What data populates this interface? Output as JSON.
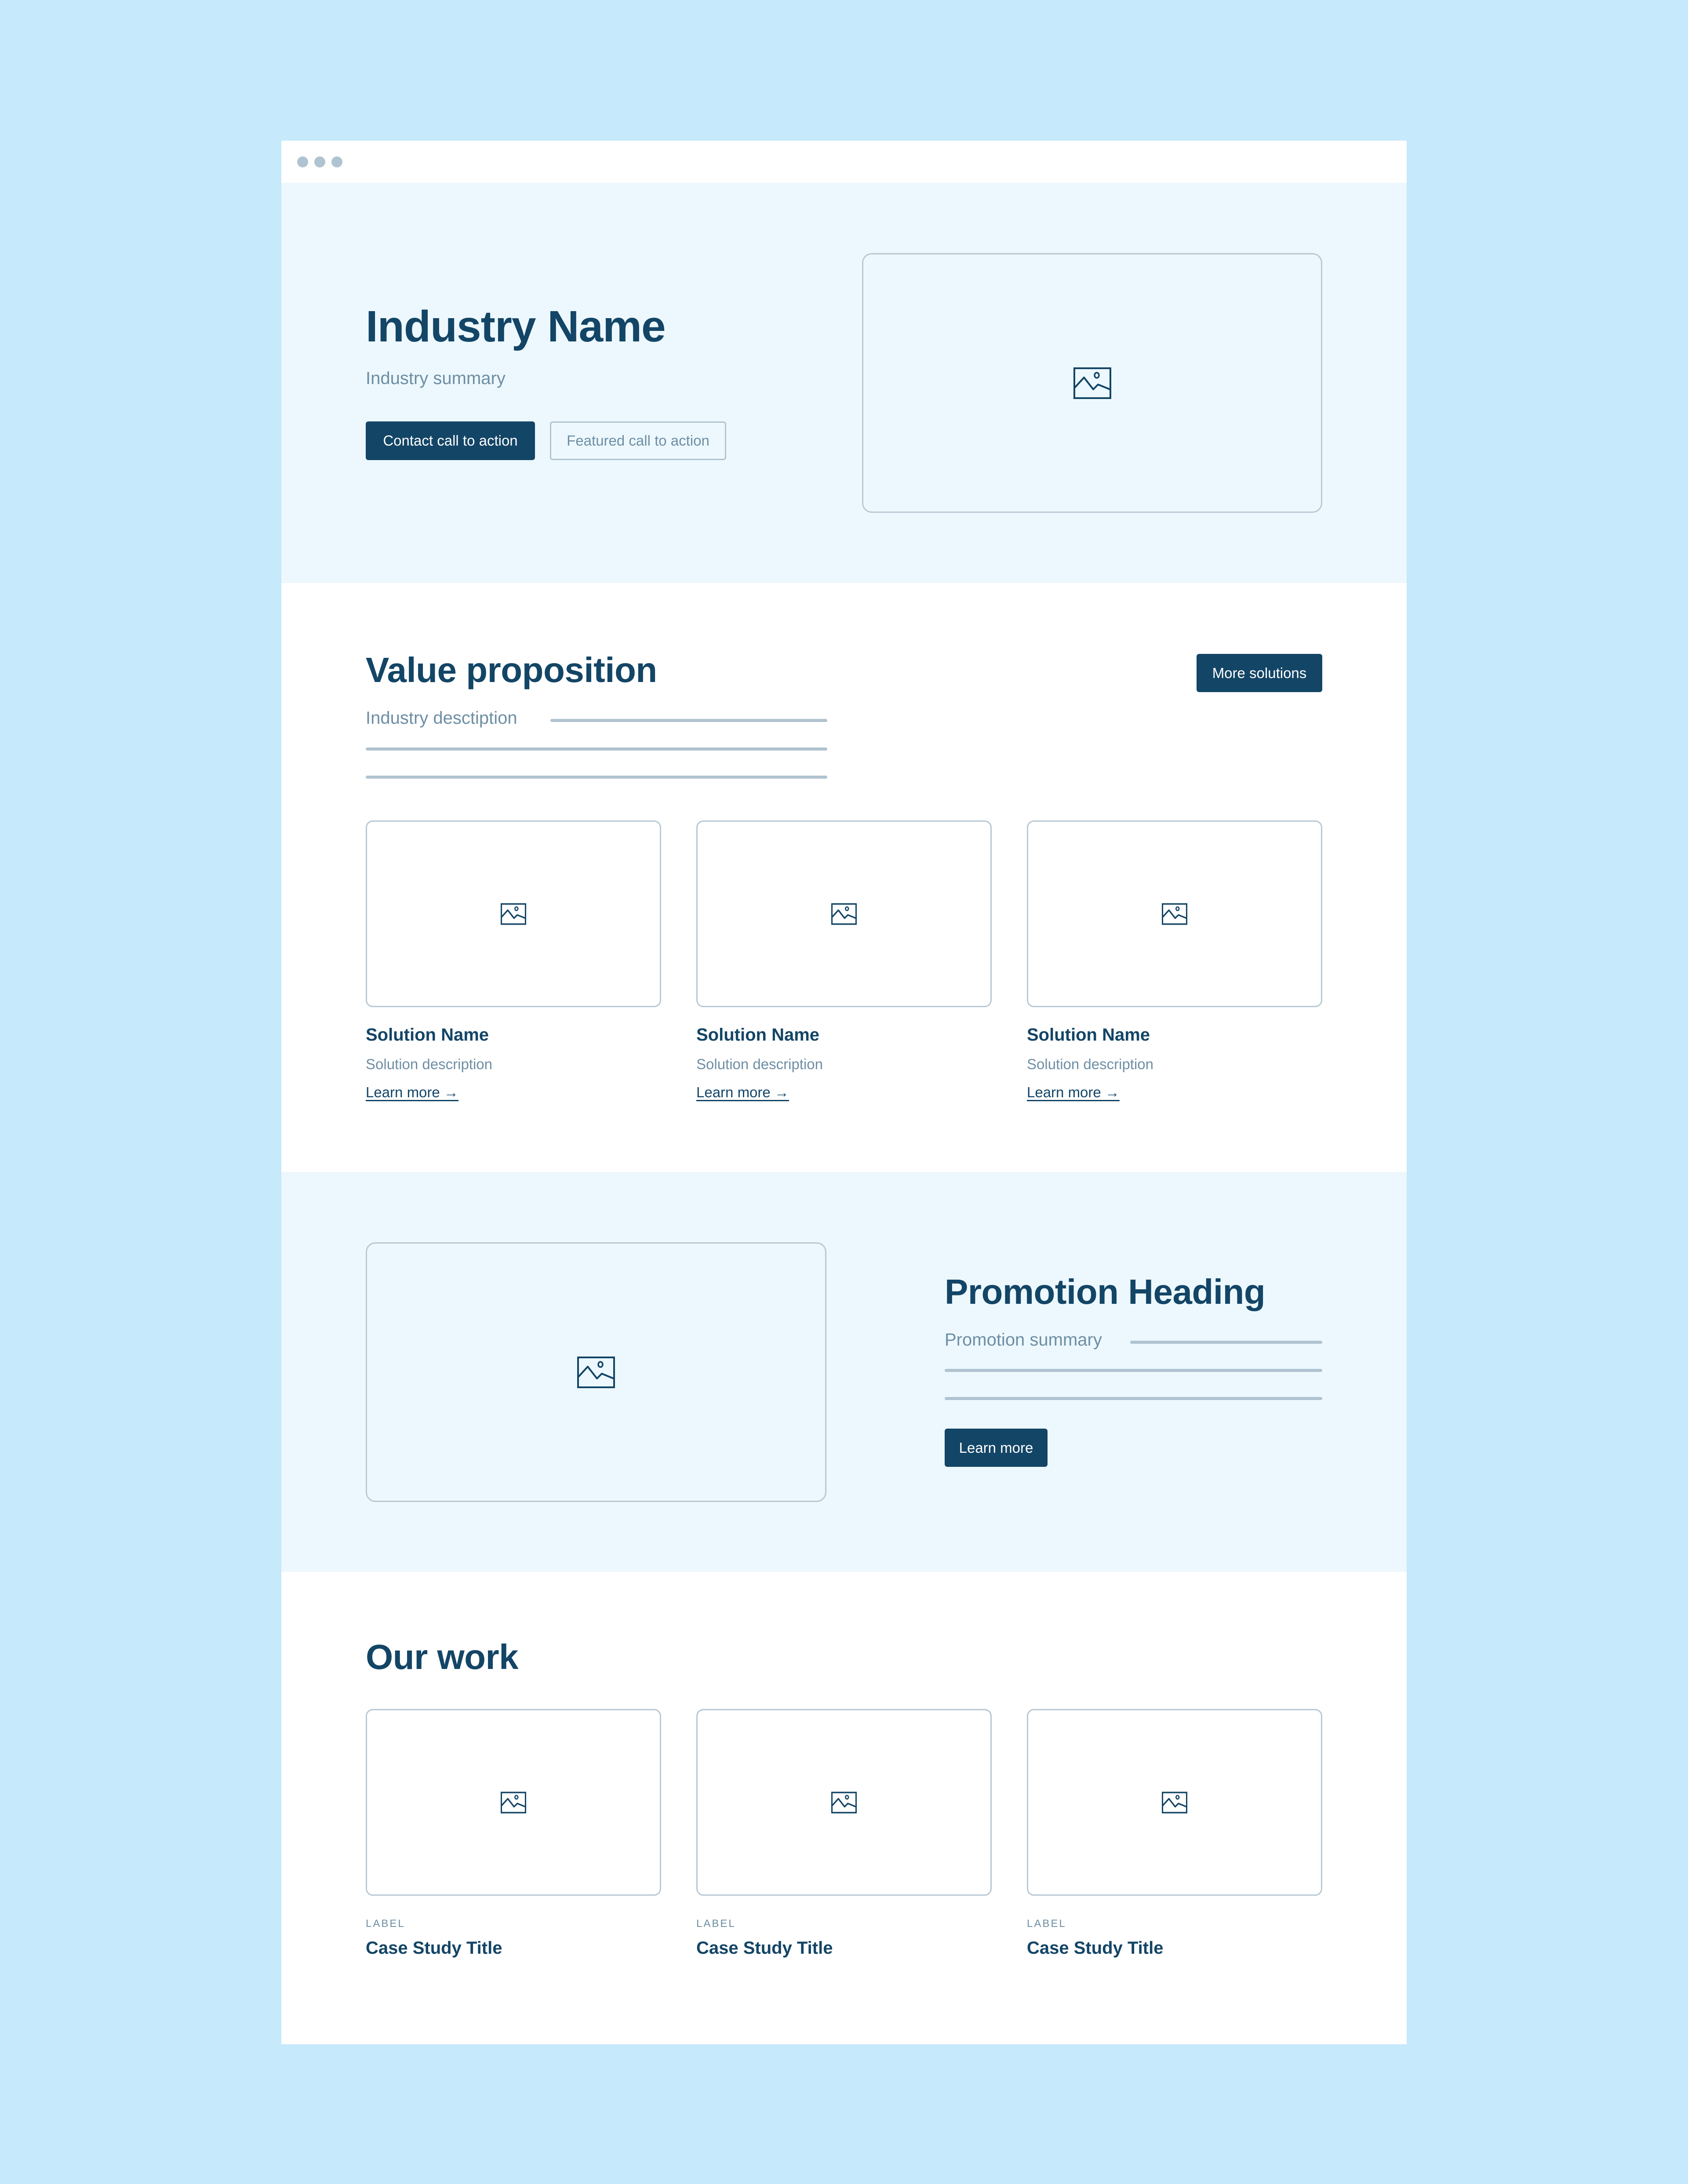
{
  "colors": {
    "background": "#c6e9fb",
    "window": "#ffffff",
    "section_tint": "#edf8fe",
    "primary": "#134566",
    "muted_text": "#6e8ea4",
    "placeholder_line": "#b0c3d0"
  },
  "window_chrome": {
    "dots": [
      "window-dot",
      "window-dot",
      "window-dot"
    ]
  },
  "hero": {
    "title": "Industry Name",
    "summary": "Industry summary",
    "primary_cta": "Contact call to action",
    "secondary_cta": "Featured call to action",
    "image_icon": "image-icon"
  },
  "value": {
    "title": "Value proposition",
    "description": "Industry desctiption",
    "more_button": "More solutions",
    "solutions": [
      {
        "name": "Solution Name",
        "description": "Solution description",
        "link": "Learn more →",
        "icon": "image-icon"
      },
      {
        "name": "Solution Name",
        "description": "Solution description",
        "link": "Learn more →",
        "icon": "image-icon"
      },
      {
        "name": "Solution Name",
        "description": "Solution description",
        "link": "Learn more →",
        "icon": "image-icon"
      }
    ]
  },
  "promotion": {
    "heading": "Promotion Heading",
    "summary": "Promotion summary",
    "button": "Learn more",
    "image_icon": "image-icon"
  },
  "work": {
    "title": "Our work",
    "case_studies": [
      {
        "label": "LABEL",
        "title": "Case Study Title",
        "icon": "image-icon"
      },
      {
        "label": "LABEL",
        "title": "Case Study Title",
        "icon": "image-icon"
      },
      {
        "label": "LABEL",
        "title": "Case Study Title",
        "icon": "image-icon"
      }
    ]
  }
}
